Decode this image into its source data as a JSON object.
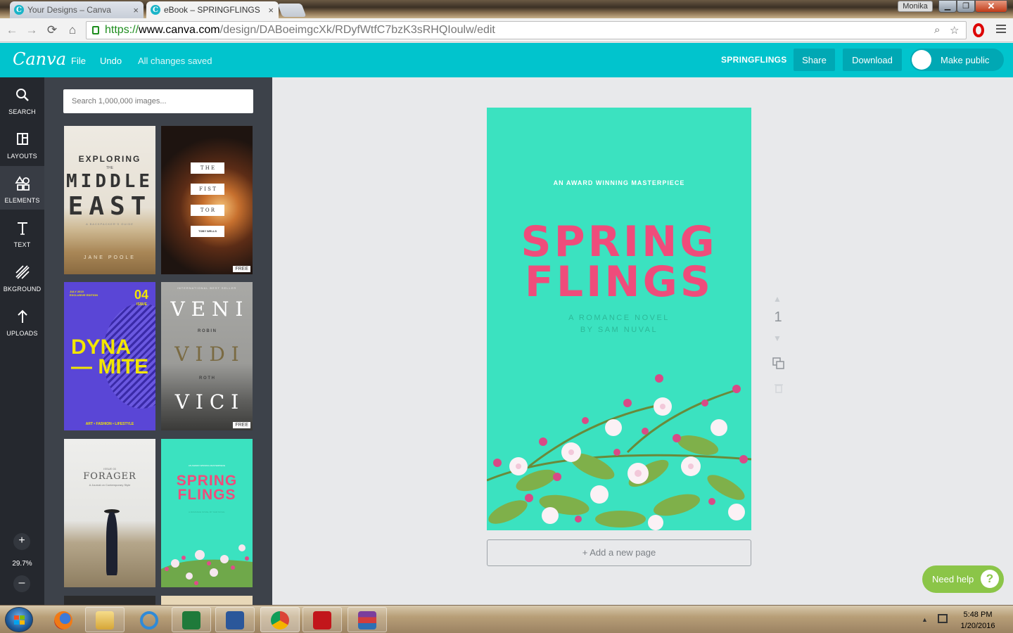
{
  "browser": {
    "tabs": [
      {
        "label": "Your Designs – Canva",
        "active": false
      },
      {
        "label": "eBook – SPRINGFLINGS",
        "active": true
      }
    ],
    "favicon_letter": "C",
    "window_user": "Monika",
    "url": {
      "protocol": "https://",
      "domain": "www.canva.com",
      "path": "/design/DABoeimgcXk/RDyfWtfC7bzK3sRHQIoulw/edit"
    }
  },
  "header": {
    "logo": "Canva",
    "menu": {
      "file": "File",
      "undo": "Undo"
    },
    "save_status": "All changes saved",
    "design_name": "SPRINGFLINGS",
    "share": "Share",
    "download": "Download",
    "make_public": "Make public",
    "brand_color": "#01c4cd"
  },
  "sidebar": {
    "items": [
      {
        "label": "SEARCH",
        "icon": "search-icon"
      },
      {
        "label": "LAYOUTS",
        "icon": "layouts-icon"
      },
      {
        "label": "ELEMENTS",
        "icon": "elements-icon"
      },
      {
        "label": "TEXT",
        "icon": "text-icon"
      },
      {
        "label": "BKGROUND",
        "icon": "background-icon"
      },
      {
        "label": "UPLOADS",
        "icon": "upload-icon"
      }
    ],
    "zoom_in": "+",
    "zoom_out": "–",
    "zoom": "29.7%"
  },
  "panel": {
    "search_placeholder": "Search 1,000,000 images...",
    "free_badge": "FREE",
    "thumbs": {
      "t1": {
        "line1": "EXPLORING",
        "line2": "THE",
        "line3": "MIDDLE",
        "line4": "EAST",
        "sub": "A BACKPACKER'S GUIDE",
        "author": "JANE POOLE"
      },
      "t2": {
        "line1": "T H E",
        "line2": "F I S T",
        "line3": "T O R",
        "author": "TOBY WELLS"
      },
      "t3": {
        "badge": "JULY 2015 EXCLUSIVE EDITION",
        "num": "04",
        "issue": "ISSUE",
        "line1": "DYNA",
        "line2": "— MITE",
        "foot": "ART • FASHION • LIFESTYLE"
      },
      "t4": {
        "kicker": "INTERNATIONAL BEST SELLER",
        "line1": "V E N I",
        "a1": "R O B I N",
        "line2": "V I D I",
        "a2": "R O T H",
        "line3": "V I C I"
      },
      "t5": {
        "kicker": "ISSUE 03",
        "title": "FORAGER",
        "sub": "A Journal on Contemporary Style"
      },
      "t6": {
        "kicker": "AN AWARD WINNING MASTERPIECE",
        "line1": "SPRING",
        "line2": "FLINGS",
        "sub": "A ROMANCE NOVEL BY SAM NUVAL"
      }
    }
  },
  "page": {
    "kicker": "AN AWARD WINNING MASTERPIECE",
    "title_line1": "SPRING",
    "title_line2": "FLINGS",
    "subtitle_line1": "A ROMANCE NOVEL",
    "subtitle_line2": "BY SAM NUVAL",
    "background_color": "#3be2c0",
    "title_color": "#ef4c7b",
    "number": "1",
    "add_page": "+ Add a new page"
  },
  "help": {
    "label": "Need help",
    "icon": "?"
  },
  "taskbar": {
    "apps": [
      "start-orb",
      "firefox",
      "file-explorer",
      "internet-explorer",
      "excel",
      "word",
      "chrome",
      "acrobat",
      "winrar"
    ],
    "time": "5:48 PM",
    "date": "1/20/2016"
  }
}
